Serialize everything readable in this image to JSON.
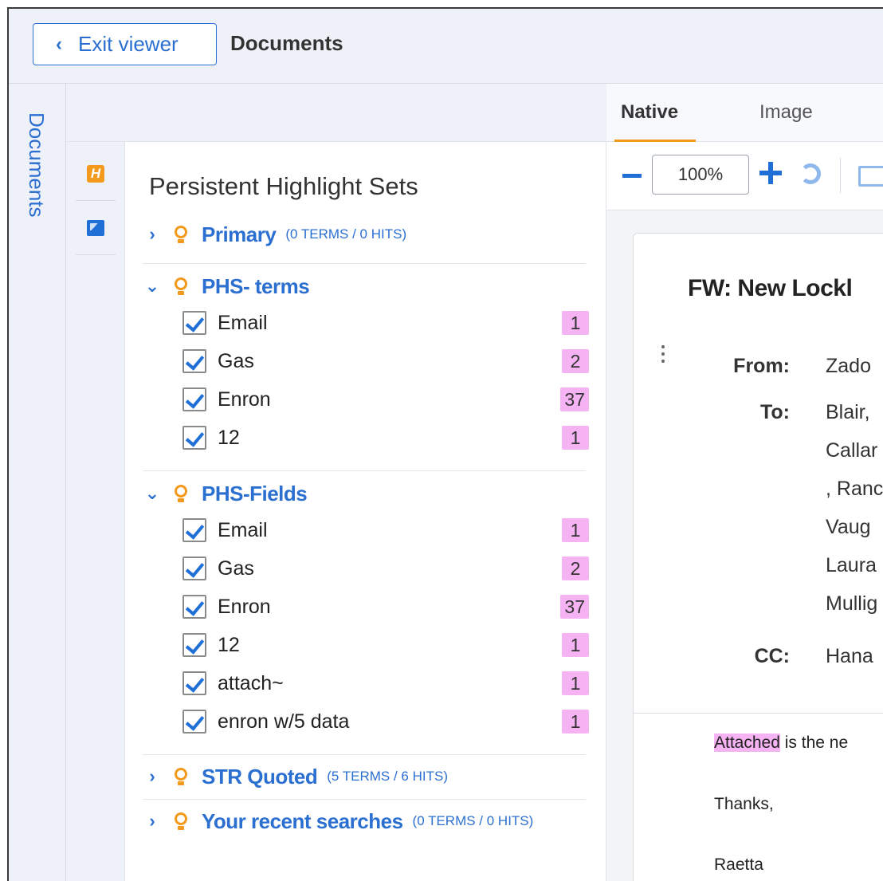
{
  "topbar": {
    "exit_label": "Exit viewer",
    "title": "Documents"
  },
  "rail": {
    "label": "Documents"
  },
  "panel": {
    "title": "Persistent Highlight Sets",
    "sets": [
      {
        "name": "Primary",
        "meta": "(0 TERMS / 0 HITS)",
        "expanded": false
      },
      {
        "name": "PHS- terms",
        "meta": "",
        "expanded": true,
        "terms": [
          {
            "label": "Email",
            "count": "1",
            "checked": true
          },
          {
            "label": "Gas",
            "count": "2",
            "checked": true
          },
          {
            "label": "Enron",
            "count": "37",
            "checked": true
          },
          {
            "label": "12",
            "count": "1",
            "checked": true
          }
        ]
      },
      {
        "name": "PHS-Fields",
        "meta": "",
        "expanded": true,
        "terms": [
          {
            "label": "Email",
            "count": "1",
            "checked": true
          },
          {
            "label": "Gas",
            "count": "2",
            "checked": true
          },
          {
            "label": "Enron",
            "count": "37",
            "checked": true
          },
          {
            "label": "12",
            "count": "1",
            "checked": true
          },
          {
            "label": "attach~",
            "count": "1",
            "checked": true
          },
          {
            "label": "enron w/5 data",
            "count": "1",
            "checked": true
          }
        ]
      },
      {
        "name": "STR Quoted",
        "meta": "(5 TERMS / 6 HITS)",
        "expanded": false
      },
      {
        "name": "Your recent searches",
        "meta": "(0 TERMS / 0 HITS)",
        "expanded": false
      }
    ]
  },
  "viewer": {
    "tabs": [
      "Native",
      "Image"
    ],
    "active_tab": "Native",
    "zoom": "100%",
    "document": {
      "subject": "FW: New Lockl",
      "from_label": "From:",
      "from_value": "Zado",
      "to_label": "To:",
      "to_values": [
        "Blair,",
        "Callar",
        ", Ranc",
        "Vaug",
        "Laura",
        "Mullig"
      ],
      "cc_label": "CC:",
      "cc_value": "Hana",
      "body_highlight": "Attached",
      "body_rest": " is the ne",
      "body_lines": [
        "Thanks,",
        "Raetta"
      ]
    }
  },
  "colors": {
    "accent": "#2b6fd1",
    "highlight": "#f6b3f4",
    "orange": "#f39a1d"
  }
}
